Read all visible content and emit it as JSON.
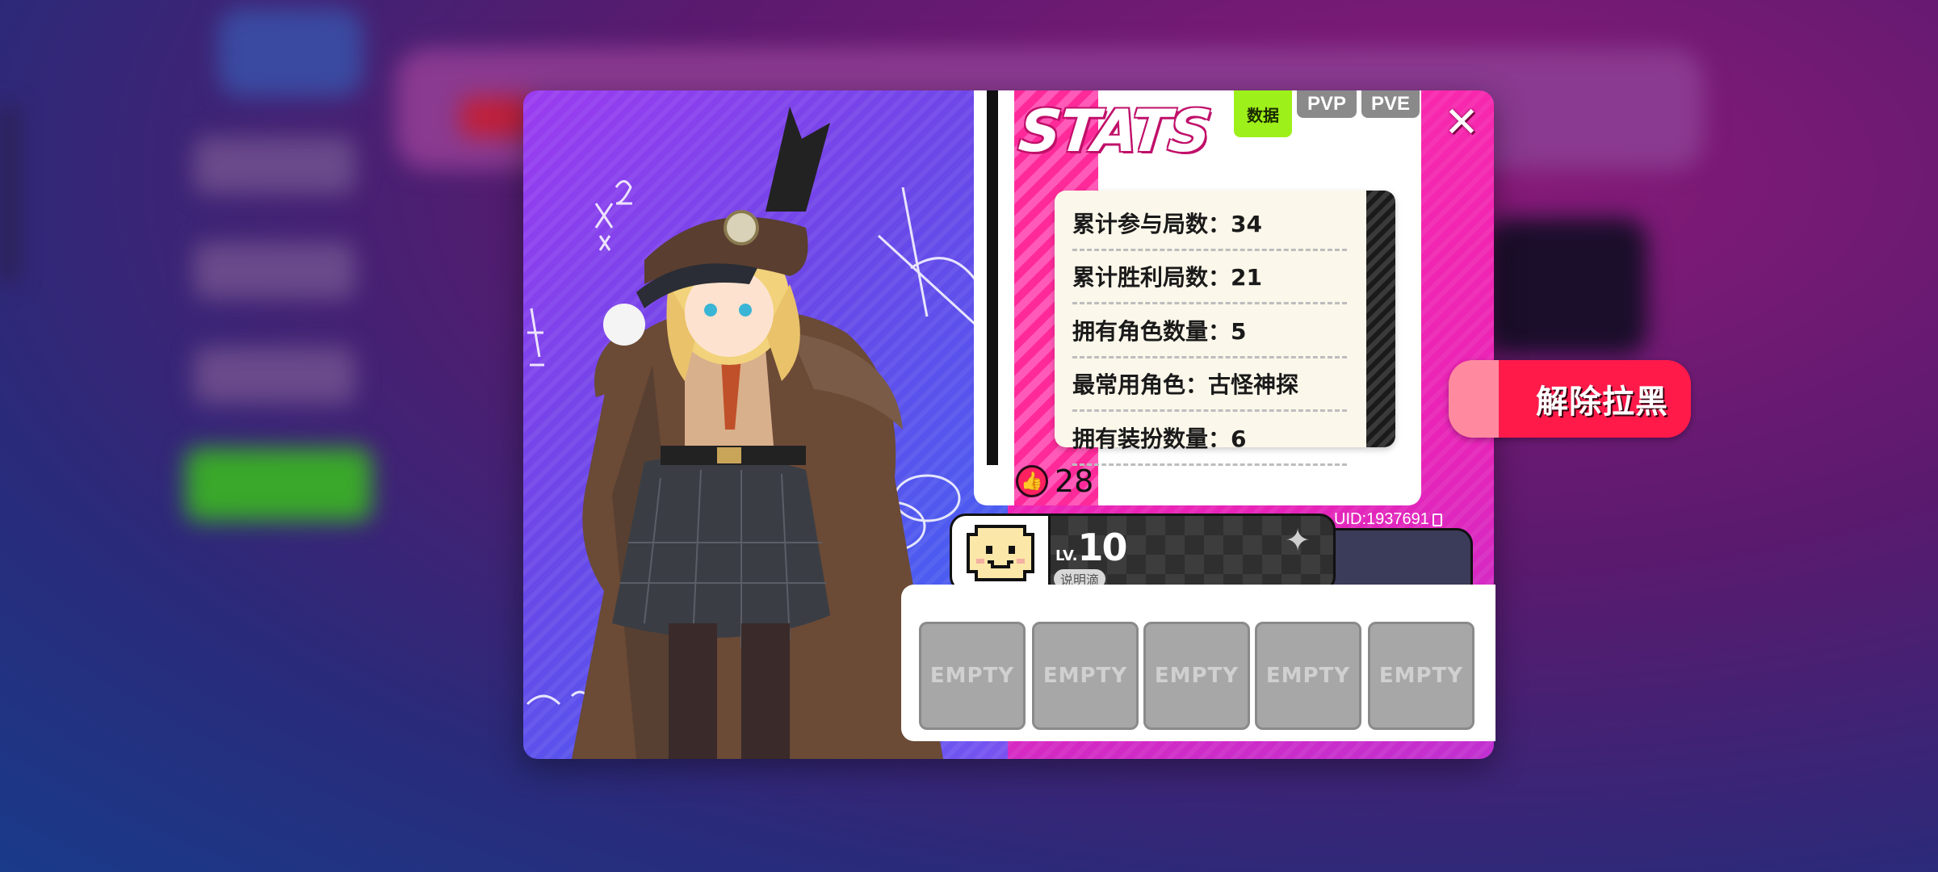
{
  "stats_panel": {
    "title": "STATS",
    "tabs": [
      "数据",
      "PVP",
      "PVE"
    ],
    "rows": [
      "累计参与局数：34",
      "累计胜利局数：21",
      "拥有角色数量：5",
      "最常用角色：古怪神探",
      "拥有装扮数量：6"
    ],
    "likes": "28"
  },
  "player": {
    "uid": "UID:1937691",
    "level_prefix": "LV.",
    "level": "10",
    "name": "说明滴"
  },
  "actions": {
    "unblock_label": "解除拉黑",
    "close_symbol": "✕"
  },
  "slots": [
    "EMPTY",
    "EMPTY",
    "EMPTY",
    "EMPTY",
    "EMPTY"
  ],
  "colors": {
    "accent_pink": "#ff2aa8",
    "unblock_red": "#ff1a4a",
    "active_tab_green": "#9ef01a",
    "inactive_tab_gray": "#8a8a8a"
  }
}
